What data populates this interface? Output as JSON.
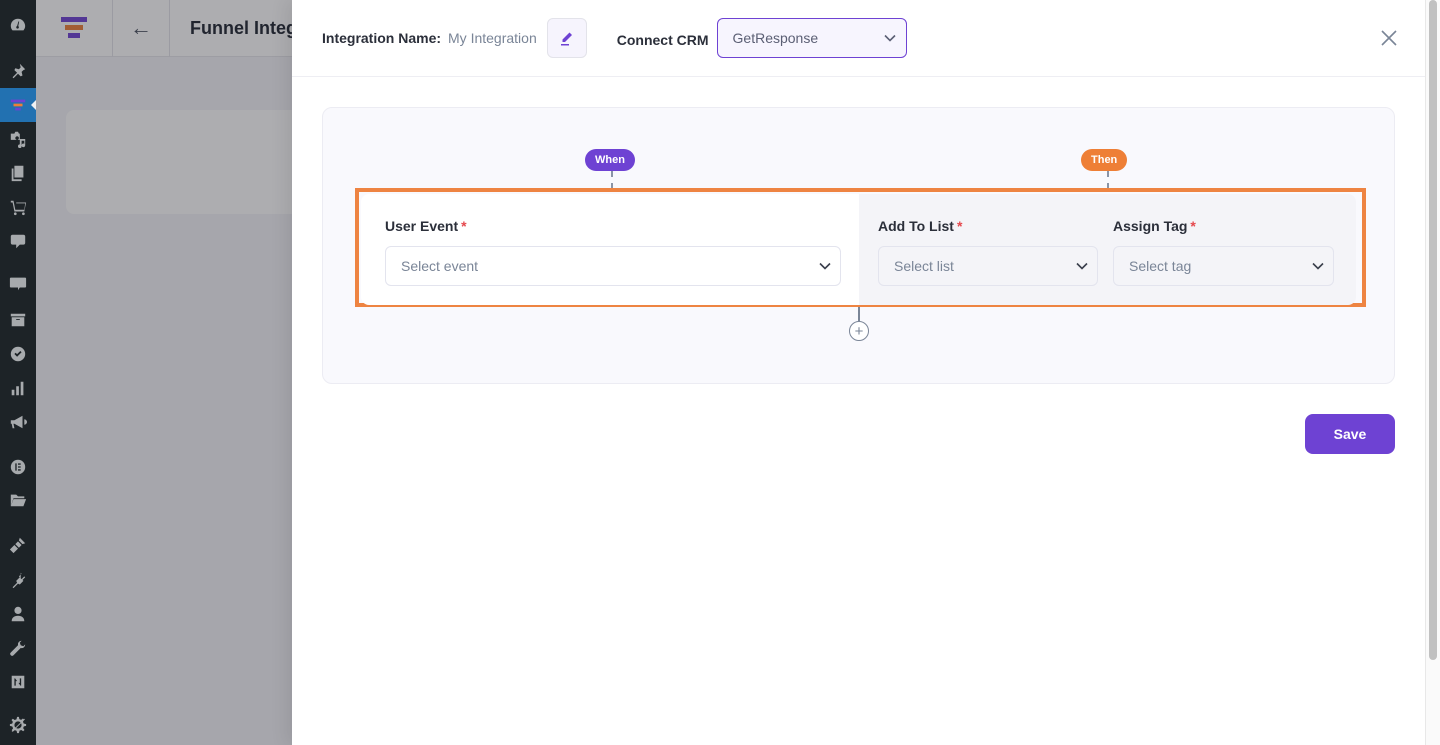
{
  "wp_sidebar": {
    "items": [
      {
        "icon": "dashboard-icon",
        "active": false
      },
      {
        "icon": "pin-icon",
        "active": false
      },
      {
        "icon": "funnel-icon",
        "active": true
      },
      {
        "icon": "media-icon",
        "active": false
      },
      {
        "icon": "pages-icon",
        "active": false
      },
      {
        "icon": "cart-icon",
        "active": false
      },
      {
        "icon": "comment-icon",
        "active": false
      },
      {
        "icon": "woo-icon",
        "active": false
      },
      {
        "icon": "archive-icon",
        "active": false
      },
      {
        "icon": "check-circle-icon",
        "active": false
      },
      {
        "icon": "bar-chart-icon",
        "active": false
      },
      {
        "icon": "megaphone-icon",
        "active": false
      },
      {
        "icon": "elementor-icon",
        "active": false
      },
      {
        "icon": "folder-icon",
        "active": false
      },
      {
        "icon": "brush-icon",
        "active": false
      },
      {
        "icon": "plugin-icon",
        "active": false
      },
      {
        "icon": "user-icon",
        "active": false
      },
      {
        "icon": "wrench-icon",
        "active": false
      },
      {
        "icon": "sliders-icon",
        "active": false
      },
      {
        "icon": "gear-slash-icon",
        "active": false
      }
    ]
  },
  "background": {
    "title": "Funnel Integrations"
  },
  "drawer": {
    "integration_name_label": "Integration Name:",
    "integration_name_value": "My Integration",
    "connect_crm_label": "Connect CRM",
    "crm_selected": "GetResponse",
    "when_pill": "When",
    "then_pill": "Then",
    "user_event": {
      "label": "User Event",
      "required": "*",
      "placeholder": "Select event"
    },
    "add_to_list": {
      "label": "Add To List",
      "required": "*",
      "placeholder": "Select list"
    },
    "assign_tag": {
      "label": "Assign Tag",
      "required": "*",
      "placeholder": "Select tag"
    },
    "add_icon": "+",
    "save_label": "Save"
  },
  "colors": {
    "primary": "#6e42d3",
    "accent_orange": "#ee7f36",
    "highlight": "#ee8442",
    "required": "#e5484d"
  }
}
